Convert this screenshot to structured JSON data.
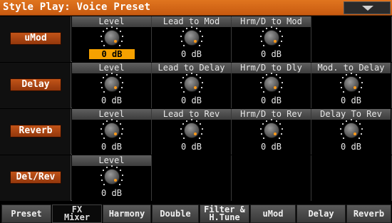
{
  "title": "Style Play: Voice Preset",
  "menu_icon": "chevron-down-icon",
  "rows": [
    {
      "label": "uMod",
      "cells": [
        {
          "header": "Level",
          "value": "0 dB",
          "selected": true
        },
        {
          "header": "Lead to Mod",
          "value": "0 dB"
        },
        {
          "header": "Hrm/D to Mod",
          "value": "0 dB"
        },
        {
          "header": "",
          "value": ""
        }
      ]
    },
    {
      "label": "Delay",
      "cells": [
        {
          "header": "Level",
          "value": "0 dB"
        },
        {
          "header": "Lead to Delay",
          "value": "0 dB"
        },
        {
          "header": "Hrm/D to Dly",
          "value": "0 dB"
        },
        {
          "header": "Mod. to Delay",
          "value": "0 dB"
        }
      ]
    },
    {
      "label": "Reverb",
      "cells": [
        {
          "header": "Level",
          "value": "0 dB"
        },
        {
          "header": "Lead to Rev",
          "value": "0 dB"
        },
        {
          "header": "Hrm/D to Rev",
          "value": "0 dB"
        },
        {
          "header": "Delay To Rev",
          "value": "0 dB"
        }
      ]
    },
    {
      "label": "Del/Rev",
      "cells": [
        {
          "header": "Level",
          "value": "0 dB"
        },
        {
          "header": "",
          "value": ""
        },
        {
          "header": "",
          "value": ""
        },
        {
          "header": "",
          "value": ""
        }
      ]
    }
  ],
  "tabs": [
    {
      "label": "Preset"
    },
    {
      "label": "FX\nMixer",
      "active": true
    },
    {
      "label": "Harmony"
    },
    {
      "label": "Double"
    },
    {
      "label": "Filter &\nH.Tune"
    },
    {
      "label": "uMod"
    },
    {
      "label": "Delay"
    },
    {
      "label": "Reverb"
    }
  ],
  "colors": {
    "title_bar": "#d5661a",
    "row_button": "#b04a14",
    "selected_value": "#f6a100",
    "knob_indicator": "#ff9a1a"
  }
}
